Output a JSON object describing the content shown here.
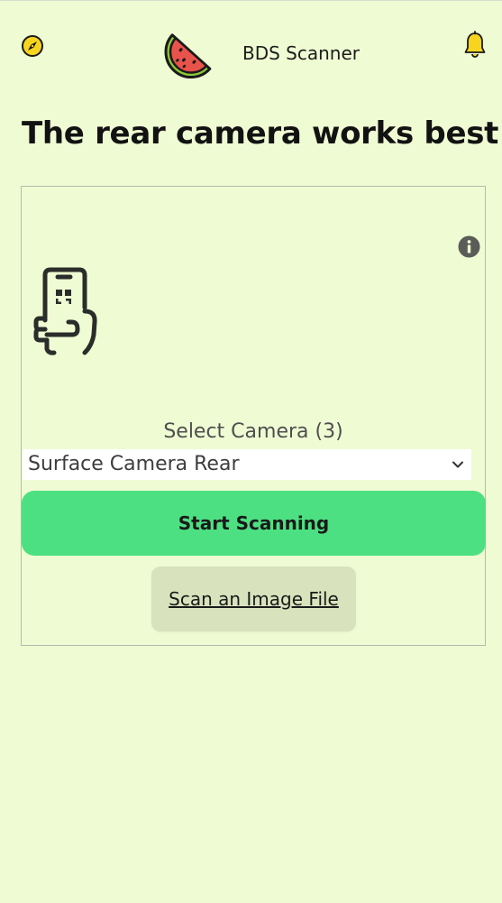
{
  "header": {
    "app_title": "BDS Scanner",
    "left_icon": "compass-icon",
    "logo_icon": "watermelon-logo",
    "right_icon": "bell-icon"
  },
  "main": {
    "heading": "The rear camera works best!"
  },
  "scanner": {
    "info_icon": "info-icon",
    "illustration_icon": "phone-qr-hand-icon",
    "select_label": "Select Camera (3)",
    "selected_camera": "Surface Camera Rear",
    "start_button": "Start Scanning",
    "file_button": "Scan an Image File"
  },
  "colors": {
    "background": "#effbd3",
    "start_button": "#4de082",
    "file_button": "#d8e3bd",
    "accent_yellow": "#f7d51f",
    "watermelon_red": "#e8534c",
    "watermelon_green": "#4a9a3b"
  }
}
